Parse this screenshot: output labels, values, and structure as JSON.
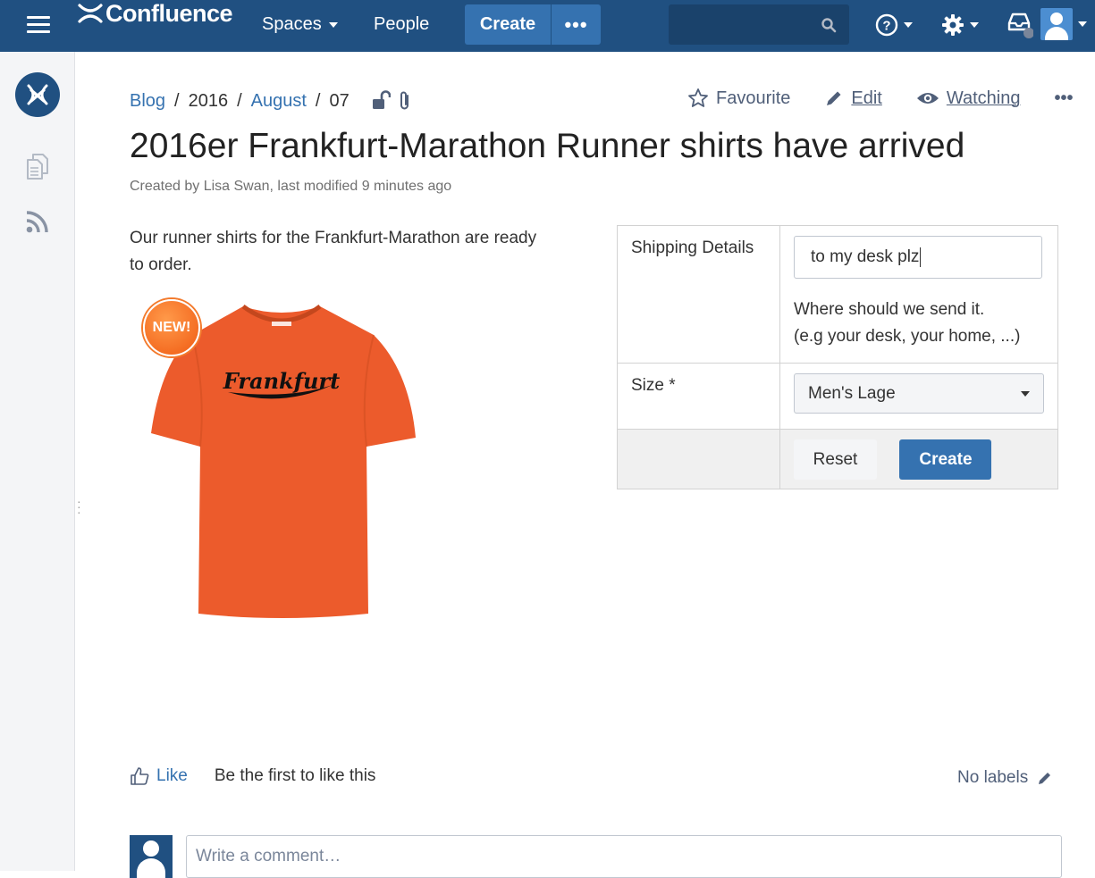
{
  "header": {
    "app_name": "Confluence",
    "nav": {
      "spaces": "Spaces",
      "people": "People"
    },
    "create_label": "Create",
    "more_label": "•••",
    "search_placeholder": ""
  },
  "sidebar": {
    "icons": [
      "space-logo-icon",
      "pages-icon",
      "rss-feed-icon"
    ]
  },
  "breadcrumb": {
    "blog": "Blog",
    "year": "2016",
    "month": "August",
    "day": "07",
    "sep": "/"
  },
  "page_actions": {
    "favourite": "Favourite",
    "edit": "Edit",
    "watching": "Watching",
    "more": "•••"
  },
  "page": {
    "title": "2016er Frankfurt-Marathon Runner shirts have arrived",
    "byline": "Created by Lisa Swan, last modified 9 minutes ago",
    "intro": "Our runner shirts for the Frankfurt-Marathon are ready to order.",
    "badge": "NEW!",
    "shirt_text": "Frankfurt"
  },
  "form": {
    "shipping_label": "Shipping Details",
    "shipping_value": "to my desk plz",
    "shipping_hint_line1": "Where should we send it.",
    "shipping_hint_line2": "(e.g your desk, your home, ...)",
    "size_label": "Size *",
    "size_value": "Men's Lage",
    "reset_label": "Reset",
    "create_label": "Create"
  },
  "footer": {
    "like_label": "Like",
    "like_text": "Be the first to like this",
    "labels_text": "No labels",
    "comment_placeholder": "Write a comment…"
  },
  "colors": {
    "header_bg": "#205081",
    "accent": "#3572b0",
    "shirt": "#ec5b2c",
    "badge": "#f37a2c"
  }
}
